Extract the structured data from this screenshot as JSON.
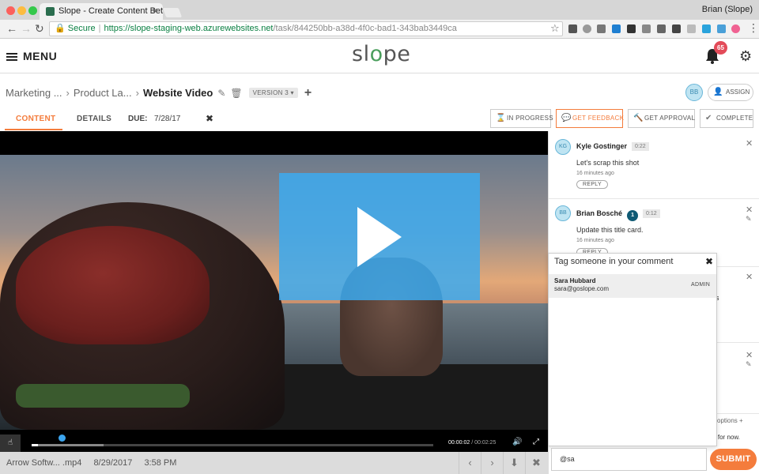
{
  "browser": {
    "tab_title": "Slope - Create Content Bette",
    "tab_close": "×",
    "profile": "Brian (Slope)",
    "secure_label": "Secure",
    "url_host": "https://slope-staging-web.azurewebsites.net",
    "url_path": "/task/844250bb-a38d-4f0c-bad1-343bab3449ca",
    "nav": {
      "back": "←",
      "forward": "→",
      "reload": "↻",
      "star": "☆"
    },
    "colors": {
      "secure": "#0b8043",
      "traffic_red": "#fc605c",
      "traffic_yellow": "#fdbc40",
      "traffic_green": "#34c84a"
    }
  },
  "header": {
    "menu_label": "MENU",
    "logo_pre": "sl",
    "logo_o": "o",
    "logo_post": "pe",
    "notification_count": "65",
    "gear_glyph": "⚙"
  },
  "breadcrumb": {
    "items": [
      "Marketing ...",
      "Product La..."
    ],
    "separator": "›",
    "current": "Website Video",
    "edit_glyph": "✎",
    "delete_glyph": "🗑",
    "version": "VERSION 3 ▾",
    "add_glyph": "+"
  },
  "assignee": {
    "initials": "BB",
    "assign_label": "ASSIGN"
  },
  "tabs": {
    "content": "CONTENT",
    "details": "DETAILS",
    "due_label": "DUE:",
    "due_value": "7/28/17",
    "due_clear": "✖"
  },
  "status_buttons": [
    {
      "label": "IN PROGRESS",
      "glyph": "⌛"
    },
    {
      "label": "GET FEEDBACK",
      "glyph": "💬"
    },
    {
      "label": "GET APPROVAL",
      "glyph": "🔨"
    },
    {
      "label": "COMPLETE",
      "glyph": "✔"
    }
  ],
  "video": {
    "current_time": "00:00:02",
    "separator": " / ",
    "duration": "00:02:25",
    "progress_fraction": 0.016,
    "buffered_fraction": 0.18,
    "volume_glyph": "🔊",
    "fullscreen_glyph": "⤢",
    "cc_glyph": "☝",
    "overlay_color": "#3caaf0"
  },
  "file": {
    "name": "Arrow Softw... .mp4",
    "date": "8/29/2017",
    "time": "3:58 PM",
    "prev": "‹",
    "next": "›",
    "download": "⬇",
    "close": "✖"
  },
  "comments": [
    {
      "initials": "KG",
      "name": "Kyle Gostinger",
      "stamp": "0:22",
      "text": "Let's scrap this shot",
      "ago": "16 minutes ago",
      "reply": "REPLY"
    },
    {
      "initials": "BB",
      "name": "Brian Bosché",
      "number": "1",
      "stamp": "0:12",
      "text": "Update this title card.",
      "ago": "16 minutes ago",
      "reply": "REPLY"
    }
  ],
  "panel": {
    "close_glyph": "✕",
    "edit_glyph": "✎",
    "fragment_s": "s",
    "options_label": "options",
    "options_plus": "+",
    "for_now_fragment": "r for now."
  },
  "tag_popup": {
    "title": "Tag someone in your comment",
    "close": "✖",
    "results": [
      {
        "name": "Sara Hubbard",
        "email": "sara@goslope.com",
        "role": "ADMIN"
      }
    ]
  },
  "composer": {
    "value": "@sa",
    "submit": "SUBMIT"
  },
  "colors": {
    "accent": "#f47c3c",
    "brand_green": "#4a9e5c",
    "badge_red": "#e34b59",
    "number_badge": "#0f5a74"
  }
}
